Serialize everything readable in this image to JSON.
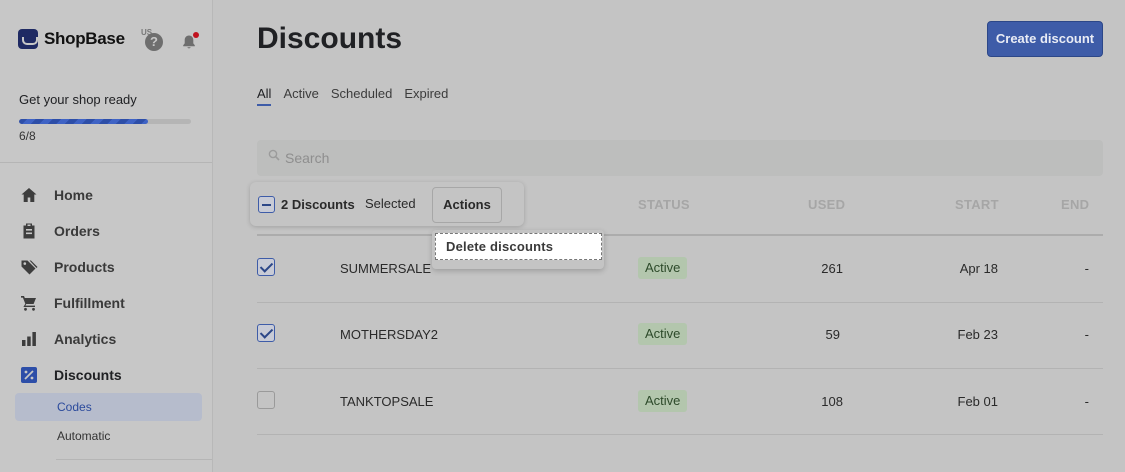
{
  "brand": {
    "name": "ShopBase",
    "region": "US"
  },
  "header": {
    "help": "?"
  },
  "onboarding": {
    "title": "Get your shop ready",
    "progress_text": "6/8",
    "progress_fraction": 0.75
  },
  "sidebar": {
    "items": [
      {
        "label": "Home",
        "icon": "home-icon"
      },
      {
        "label": "Orders",
        "icon": "clipboard-icon"
      },
      {
        "label": "Products",
        "icon": "tag-icon"
      },
      {
        "label": "Fulfillment",
        "icon": "cart-icon"
      },
      {
        "label": "Analytics",
        "icon": "bar-chart-icon"
      },
      {
        "label": "Discounts",
        "icon": "percent-icon"
      }
    ],
    "sub_items": [
      {
        "label": "Codes"
      },
      {
        "label": "Automatic"
      }
    ]
  },
  "page": {
    "title": "Discounts",
    "create_button": "Create discount",
    "tabs": [
      "All",
      "Active",
      "Scheduled",
      "Expired"
    ],
    "search_placeholder": "Search"
  },
  "table": {
    "columns": {
      "status": "STATUS",
      "used": "USED",
      "start": "START",
      "end": "END"
    },
    "rows": [
      {
        "code": "SUMMERSALE",
        "status": "Active",
        "used": "261",
        "start": "Apr 18",
        "end": "-",
        "checked": true
      },
      {
        "code": "MOTHERSDAY2",
        "status": "Active",
        "used": "59",
        "start": "Feb 23",
        "end": "-",
        "checked": true
      },
      {
        "code": "TANKTOPSALE",
        "status": "Active",
        "used": "108",
        "start": "Feb 01",
        "end": "-",
        "checked": false
      }
    ]
  },
  "bulk": {
    "count_label": "2 Discounts",
    "selected_label": "Selected",
    "actions_label": "Actions",
    "menu_item": "Delete discounts"
  },
  "colors": {
    "accent": "#3e5ca8",
    "status_bg": "#b3c6ad"
  }
}
